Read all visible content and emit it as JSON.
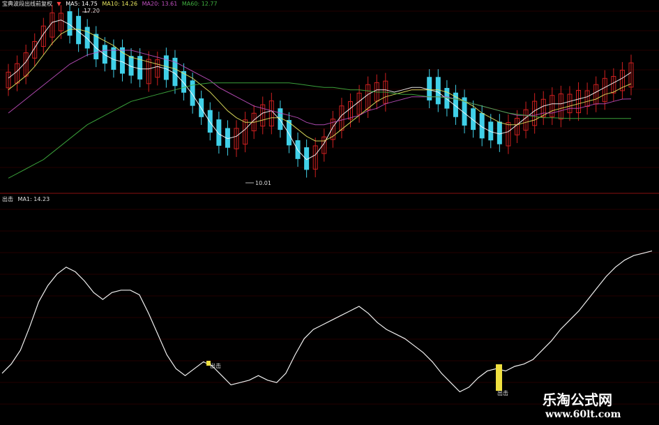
{
  "upper_panel": {
    "title": "宝典波段出线前复权",
    "indicators": [
      {
        "label": "MA5: 14.75",
        "color": "#ffffff"
      },
      {
        "label": "MA10: 14.26",
        "color": "#e8e860"
      },
      {
        "label": "MA20: 13.61",
        "color": "#c050c0"
      },
      {
        "label": "MA60: 12.77",
        "color": "#40b040"
      }
    ],
    "high_label": "17.20",
    "low_label": "10.01"
  },
  "lower_panel": {
    "title": "出击",
    "ma_label": "MA1: 14.23",
    "signal_label": "出击"
  },
  "watermark": {
    "cn": "乐淘公式网",
    "url": "www.60lt.com"
  },
  "colors": {
    "up": "#d02020",
    "down": "#40d0e8",
    "ma5": "#ffffff",
    "ma10": "#e8e860",
    "ma20": "#c050c0",
    "ma60": "#40b040",
    "grid": "#6a0000",
    "signal": "#f0e040"
  },
  "chart_data": [
    {
      "type": "candlestick",
      "series": [
        {
          "name": "MA5",
          "values": [
            14.5,
            14.8,
            15.2,
            15.8,
            16.4,
            16.9,
            17.0,
            16.8,
            16.5,
            16.2,
            15.8,
            15.5,
            15.3,
            15.2,
            15.0,
            14.9,
            14.9,
            15.0,
            14.9,
            14.7,
            14.3,
            13.8,
            13.2,
            12.6,
            12.1,
            11.9,
            12.0,
            12.3,
            12.7,
            13.0,
            13.1,
            12.7,
            12.1,
            11.4,
            11.0,
            11.2,
            11.7,
            12.4,
            12.9,
            13.2,
            13.5,
            13.8,
            14.0,
            14.0,
            13.9,
            14.0,
            14.1,
            14.1,
            14.0,
            13.9,
            13.6,
            13.3,
            13.0,
            12.7,
            12.4,
            12.2,
            12.1,
            12.2,
            12.5,
            12.8,
            13.1,
            13.3,
            13.4,
            13.4,
            13.5,
            13.6,
            13.7,
            13.9,
            14.1,
            14.3,
            14.5,
            14.75
          ]
        },
        {
          "name": "MA10",
          "values": [
            14.0,
            14.3,
            14.6,
            15.0,
            15.5,
            16.0,
            16.4,
            16.6,
            16.6,
            16.5,
            16.3,
            16.1,
            15.9,
            15.6,
            15.4,
            15.3,
            15.2,
            15.1,
            15.0,
            14.9,
            14.7,
            14.5,
            14.2,
            13.9,
            13.5,
            13.1,
            12.8,
            12.6,
            12.6,
            12.7,
            12.8,
            12.8,
            12.6,
            12.3,
            12.0,
            11.8,
            11.8,
            12.0,
            12.3,
            12.6,
            12.9,
            13.2,
            13.5,
            13.7,
            13.8,
            13.9,
            14.0,
            14.0,
            14.0,
            14.0,
            13.9,
            13.7,
            13.5,
            13.3,
            13.0,
            12.8,
            12.6,
            12.5,
            12.5,
            12.6,
            12.7,
            12.9,
            13.1,
            13.2,
            13.3,
            13.4,
            13.5,
            13.6,
            13.8,
            13.9,
            14.1,
            14.26
          ]
        },
        {
          "name": "MA20",
          "values": [
            13.0,
            13.3,
            13.6,
            13.9,
            14.2,
            14.5,
            14.8,
            15.1,
            15.3,
            15.5,
            15.6,
            15.7,
            15.7,
            15.7,
            15.7,
            15.6,
            15.5,
            15.4,
            15.3,
            15.2,
            15.0,
            14.8,
            14.6,
            14.4,
            14.1,
            13.9,
            13.7,
            13.5,
            13.3,
            13.2,
            13.1,
            13.0,
            12.9,
            12.8,
            12.6,
            12.5,
            12.5,
            12.6,
            12.7,
            12.8,
            12.9,
            13.1,
            13.2,
            13.4,
            13.5,
            13.6,
            13.7,
            13.7,
            13.7,
            13.7,
            13.7,
            13.6,
            13.5,
            13.4,
            13.3,
            13.2,
            13.1,
            13.0,
            12.9,
            12.9,
            12.9,
            13.0,
            13.0,
            13.1,
            13.2,
            13.2,
            13.3,
            13.4,
            13.4,
            13.5,
            13.6,
            13.61
          ]
        },
        {
          "name": "MA60",
          "values": [
            10.2,
            10.4,
            10.6,
            10.8,
            11.0,
            11.3,
            11.6,
            11.9,
            12.2,
            12.5,
            12.7,
            12.9,
            13.1,
            13.3,
            13.5,
            13.6,
            13.7,
            13.8,
            13.9,
            14.0,
            14.1,
            14.2,
            14.25,
            14.3,
            14.3,
            14.3,
            14.3,
            14.3,
            14.3,
            14.3,
            14.3,
            14.3,
            14.3,
            14.25,
            14.2,
            14.15,
            14.1,
            14.1,
            14.05,
            14.0,
            14.0,
            13.95,
            13.9,
            13.9,
            13.85,
            13.8,
            13.8,
            13.75,
            13.7,
            13.7,
            13.65,
            13.6,
            13.5,
            13.4,
            13.3,
            13.2,
            13.1,
            13.0,
            12.95,
            12.9,
            12.85,
            12.8,
            12.8,
            12.78,
            12.77,
            12.77,
            12.77,
            12.77,
            12.77,
            12.77,
            12.77,
            12.77
          ]
        }
      ],
      "ohlc_note": "candles reconstructed approximately from the figure",
      "price_ylim": [
        10.0,
        17.5
      ],
      "high": 17.2,
      "low": 10.01
    },
    {
      "type": "line",
      "title": "出击",
      "series": [
        {
          "name": "MA1",
          "values": [
            13.0,
            13.4,
            14.0,
            15.0,
            16.1,
            16.8,
            17.3,
            17.6,
            17.4,
            17.0,
            16.5,
            16.2,
            16.5,
            16.6,
            16.6,
            16.4,
            15.6,
            14.7,
            13.8,
            13.2,
            12.9,
            13.2,
            13.5,
            13.3,
            12.9,
            12.5,
            12.6,
            12.7,
            12.9,
            12.7,
            12.6,
            13.0,
            13.8,
            14.5,
            14.9,
            15.1,
            15.3,
            15.5,
            15.7,
            15.9,
            15.6,
            15.2,
            14.9,
            14.7,
            14.5,
            14.2,
            13.9,
            13.5,
            13.0,
            12.6,
            12.2,
            12.4,
            12.8,
            13.1,
            13.2,
            13.1,
            13.3,
            13.4,
            13.6,
            14.0,
            14.4,
            14.9,
            15.3,
            15.7,
            16.2,
            16.7,
            17.2,
            17.6,
            17.9,
            18.1,
            18.2,
            18.3
          ]
        }
      ],
      "ylim": [
        12.0,
        18.5
      ],
      "signals": [
        19,
        49
      ]
    }
  ]
}
